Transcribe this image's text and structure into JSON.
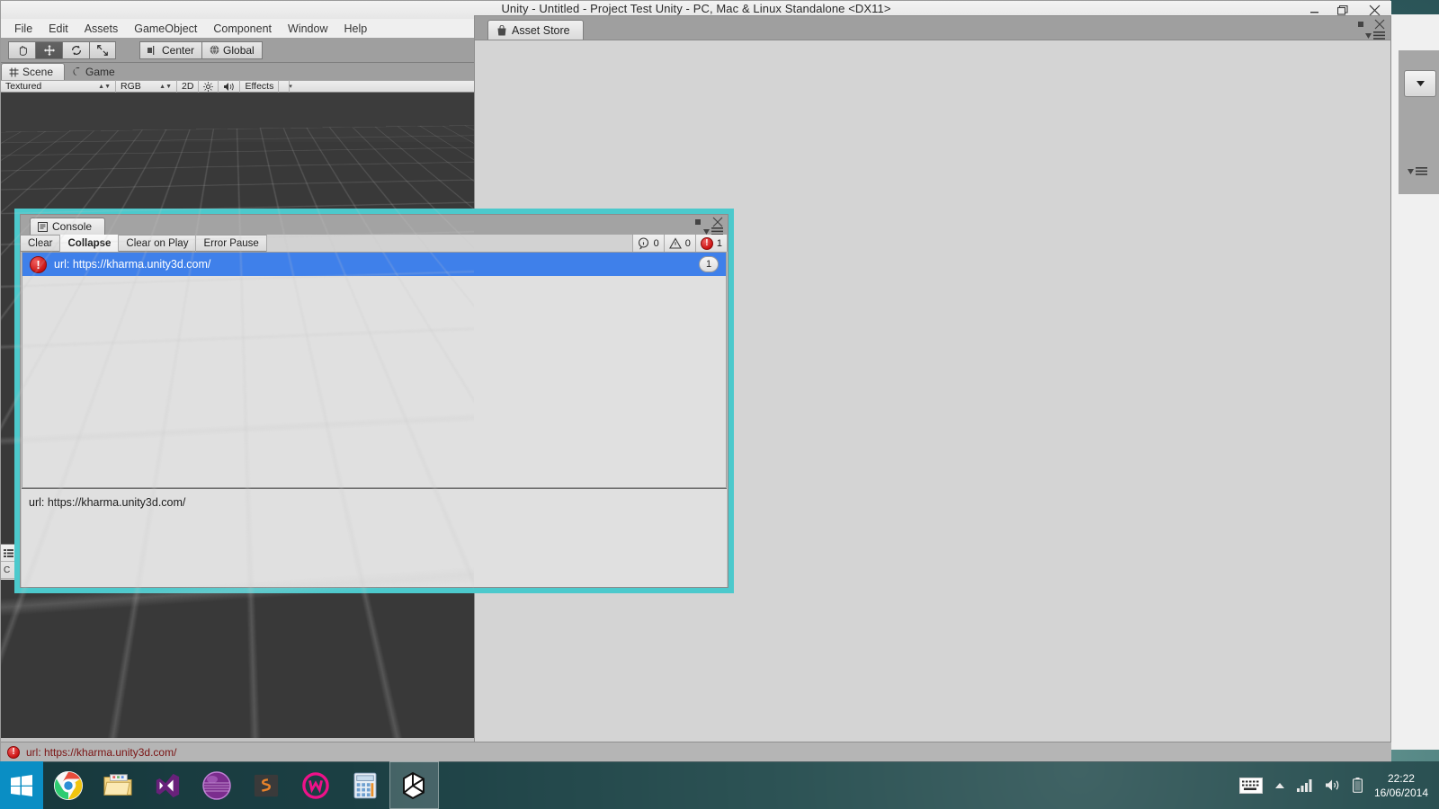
{
  "window": {
    "title": "Unity - Untitled - Project Test Unity - PC, Mac & Linux Standalone <DX11>",
    "minimize_label": "minimize",
    "maximize_label": "maximize",
    "close_label": "close"
  },
  "menu": {
    "items": [
      {
        "label": "File"
      },
      {
        "label": "Edit"
      },
      {
        "label": "Assets"
      },
      {
        "label": "GameObject"
      },
      {
        "label": "Component"
      },
      {
        "label": "Window"
      },
      {
        "label": "Help"
      }
    ]
  },
  "toolbar": {
    "tools": [
      {
        "name": "hand-tool",
        "glyph": "✋"
      },
      {
        "name": "move-tool",
        "glyph": "✥"
      },
      {
        "name": "rotate-tool",
        "glyph": "⟳"
      },
      {
        "name": "scale-tool",
        "glyph": "⤢"
      }
    ],
    "pivot_label": "Center",
    "space_label": "Global"
  },
  "view_tabs": [
    {
      "label": "Scene",
      "icon": "grid-icon",
      "active": true
    },
    {
      "label": "Game",
      "icon": "gamepad-icon",
      "active": false
    }
  ],
  "scene_toolbar": {
    "draw_mode": "Textured",
    "color_mode": "RGB",
    "two_d": "2D",
    "lighting_icon": "sun-icon",
    "audio_icon": "speaker-icon",
    "effects": "Effects"
  },
  "asset_store": {
    "tab_label": "Asset Store",
    "tab_icon": "shopping-bag-icon"
  },
  "console": {
    "tab_label": "Console",
    "tab_icon": "console-icon",
    "buttons": [
      {
        "label": "Clear",
        "toggled": false
      },
      {
        "label": "Collapse",
        "toggled": true
      },
      {
        "label": "Clear on Play",
        "toggled": false
      },
      {
        "label": "Error Pause",
        "toggled": false
      }
    ],
    "counters": {
      "info_icon": "info-icon",
      "info_count": "0",
      "warning_icon": "warning-icon",
      "warning_count": "0",
      "error_icon": "error-icon",
      "error_count": "1"
    },
    "log_entries": [
      {
        "icon": "error-icon",
        "message": "url: https://kharma.unity3d.com/",
        "collapse_count": "1",
        "selected": true
      }
    ],
    "detail_text": "url: https://kharma.unity3d.com/"
  },
  "status_bar": {
    "icon": "error-icon",
    "message": "url: https://kharma.unity3d.com/"
  },
  "taskbar": {
    "start_label": "start",
    "items": [
      {
        "name": "chrome",
        "active": false
      },
      {
        "name": "file-explorer",
        "active": false
      },
      {
        "name": "visual-studio",
        "active": false
      },
      {
        "name": "purple-sphere-app",
        "active": false
      },
      {
        "name": "sublime-text",
        "active": false
      },
      {
        "name": "wacom-app",
        "active": false
      },
      {
        "name": "calculator",
        "active": false
      },
      {
        "name": "unity",
        "active": true
      }
    ],
    "tray": {
      "keyboard_icon": "keyboard-icon",
      "show_hidden_icon": "chevron-up-icon",
      "network_icon": "signal-icon",
      "volume_icon": "speaker-icon",
      "battery_icon": "battery-icon",
      "time": "22:22",
      "date": "16/06/2014"
    }
  },
  "colors": {
    "console_border": "#4cc9cc",
    "selection_blue": "#3f80ea",
    "error_red": "#cc1414",
    "status_text": "#7a1414"
  }
}
